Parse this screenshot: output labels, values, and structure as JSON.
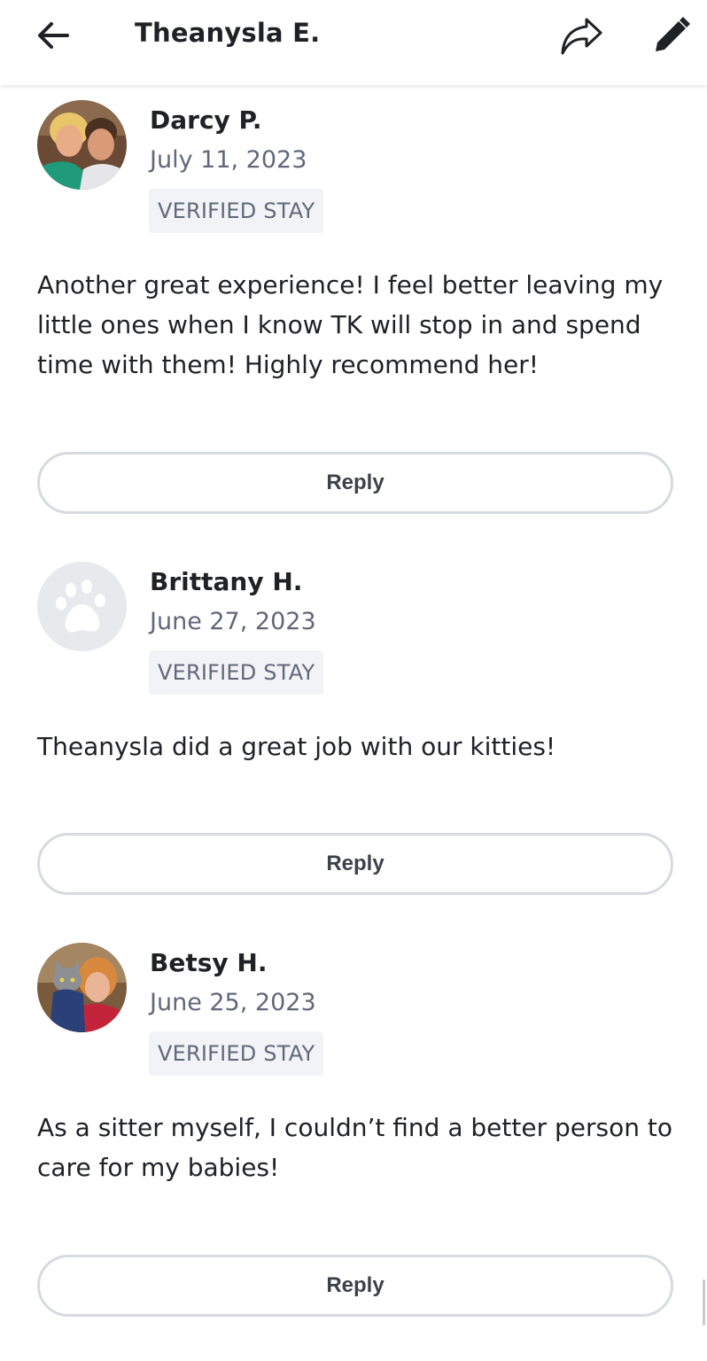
{
  "header": {
    "title": "Theanysla E.",
    "back_icon": "arrow-left-icon",
    "share_icon": "share-arrow-icon",
    "edit_icon": "pencil-icon"
  },
  "reviews": [
    {
      "name": "Darcy P.",
      "date": "July 11, 2023",
      "badge": "VERIFIED STAY",
      "text": "Another great experience! I feel better leaving my little ones when I know TK will stop in and spend time with them! Highly recommend her!",
      "reply_label": "Reply",
      "avatar": "photo-couple"
    },
    {
      "name": "Brittany H.",
      "date": "June 27, 2023",
      "badge": "VERIFIED STAY",
      "text": "Theanysla did a great job with our kitties!",
      "reply_label": "Reply",
      "avatar": "paw-placeholder-icon"
    },
    {
      "name": "Betsy H.",
      "date": "June 25, 2023",
      "badge": "VERIFIED STAY",
      "text": "As a sitter myself, I couldn’t find a better person to care for my babies!",
      "reply_label": "Reply",
      "avatar": "photo-woman-with-cat"
    }
  ],
  "colors": {
    "text_primary": "#1f2125",
    "text_secondary": "#62687a",
    "badge_bg": "#f1f3f6",
    "button_border": "#d7dae0"
  }
}
